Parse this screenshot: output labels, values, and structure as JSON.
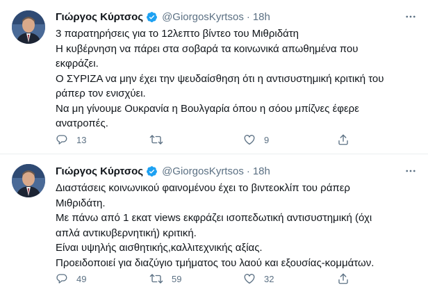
{
  "colors": {
    "text": "#0f1419",
    "secondary": "#5b7083",
    "verified": "#1da1f2",
    "divider": "#ebeef0"
  },
  "tweets": [
    {
      "author": {
        "name": "Γιώργος Κύρτσος",
        "handle": "@GiorgosKyrtsos",
        "verified": true
      },
      "time": "18h",
      "lines": [
        "3 παρατηρήσεις για το 12λεπτο βίντεο του Μιθριδάτη",
        "Η κυβέρνηση να πάρει στα σοβαρά τα κοινωνικά απωθημένα που",
        "εκφράζει.",
        "Ο ΣΥΡΙΖΑ να μην έχει την ψευδαίσθηση ότι η αντισυστημική κριτική του",
        "ράπερ τον ενισχύει.",
        "Να μη γίνουμε Ουκρανία η Βουλγαρία όπου η σόου μπίζνες έφερε",
        "ανατροπές."
      ],
      "replies": "13",
      "retweets": "",
      "likes": "9"
    },
    {
      "author": {
        "name": "Γιώργος Κύρτσος",
        "handle": "@GiorgosKyrtsos",
        "verified": true
      },
      "time": "18h",
      "lines": [
        "Διαστάσεις κοινωνικού φαινομένου έχει το βιντεοκλίπ του ράπερ",
        "Μιθριδάτη.",
        "Με πάνω από 1 εκατ views εκφράζει ισοπεδωτική αντισυστημική (όχι",
        "απλά αντικυβερνητική) κριτική.",
        "Είναι υψηλής αισθητικής,καλλιτεχνικής αξίας.",
        "Προειδοποιεί για διαζύγιο τμήματος του λαού και εξουσίας-κομμάτων."
      ],
      "replies": "49",
      "retweets": "59",
      "likes": "32"
    }
  ],
  "icons": {
    "more": "more-options-icon",
    "reply": "reply-icon",
    "retweet": "retweet-icon",
    "like": "like-icon",
    "share": "share-icon",
    "verified": "verified-badge-icon"
  }
}
